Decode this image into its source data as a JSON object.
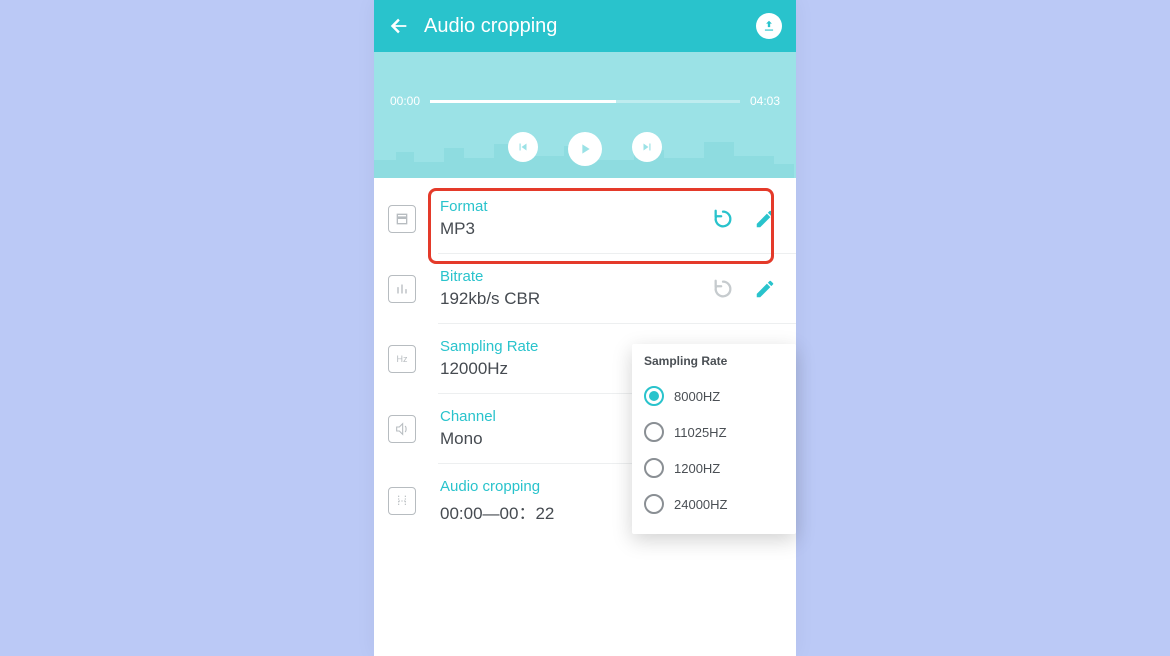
{
  "appbar": {
    "title": "Audio cropping"
  },
  "player": {
    "start": "00:00",
    "end": "04:03"
  },
  "rows": [
    {
      "label": "Format",
      "value": "MP3"
    },
    {
      "label": "Bitrate",
      "value": "192kb/s CBR"
    },
    {
      "label": "Sampling Rate",
      "value": "12000Hz"
    },
    {
      "label": "Channel",
      "value": "Mono"
    },
    {
      "label": "Audio cropping",
      "value": "00:00—00：22"
    }
  ],
  "popup": {
    "title": "Sampling Rate",
    "options": [
      "8000HZ",
      "11025HZ",
      "1200HZ",
      "24000HZ"
    ],
    "selected_index": 0
  },
  "colors": {
    "accent": "#29C3CC",
    "accent_light": "#9BE2E6",
    "inactive": "#B7BCC0",
    "highlight_border": "#E43A2A"
  }
}
